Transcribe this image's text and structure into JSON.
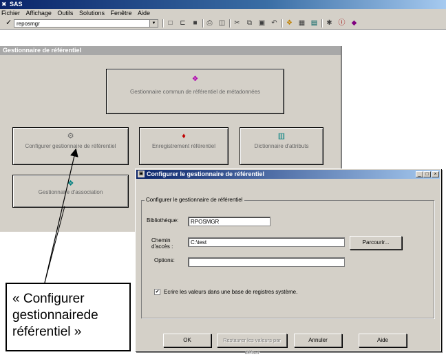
{
  "app": {
    "title": "SAS"
  },
  "menu": [
    "Fichier",
    "Affichage",
    "Outils",
    "Solutions",
    "Fenêtre",
    "Aide"
  ],
  "toolbar": {
    "combo_value": "reposmgr",
    "icons": [
      "new-icon",
      "open-icon",
      "save-icon",
      "print-icon",
      "preview-icon",
      "cut-icon",
      "copy-icon",
      "paste-icon",
      "undo-icon",
      "explorer-icon",
      "results-icon",
      "library-icon",
      "run-icon",
      "help-icon",
      "sas-icon"
    ]
  },
  "panel": {
    "title": "Gestionnaire de référentiel",
    "buttons": {
      "common": "Gestionnaire commun de référentiel de métadonnées",
      "configure": "Configurer gestionnaire de référentiel",
      "register": "Enregistrement référentiel",
      "dictionary": "Dictionnaire d'attributs",
      "association": "Gestionnaire d'association"
    }
  },
  "dialog": {
    "title": "Configurer le gestionnaire de référentiel",
    "group_label": "Configurer le gestionnaire de référentiel",
    "library_label": "Bibliothèque:",
    "library_value": "RPOSMGR",
    "path_label": "Chemin\nd'accès :",
    "path_value": "C:\\test",
    "browse_label": "Parcourir...",
    "options_label": "Options:",
    "options_value": "",
    "checkbox_label": "Ecrire les valeurs dans une base de registres système.",
    "checkbox_checked": true,
    "buttons": {
      "ok": "OK",
      "restore": "Restaurer les valeurs par défaut",
      "cancel": "Annuler",
      "help": "Aide"
    }
  },
  "callout": {
    "text": "« Configurer gestionnairede référentiel »"
  }
}
